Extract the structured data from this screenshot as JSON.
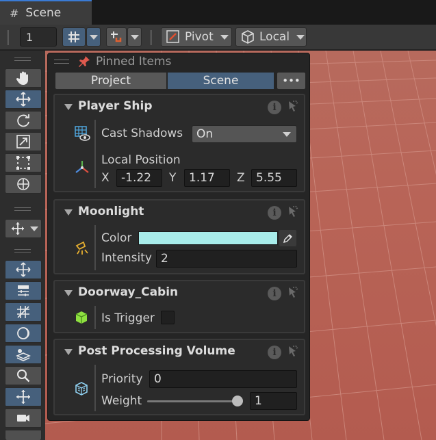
{
  "tab": {
    "title": "Scene",
    "icon": "hash-grid-icon"
  },
  "toolbar": {
    "grid_value": "1",
    "pivot_label": "Pivot",
    "local_label": "Local"
  },
  "palette": {
    "tools": [
      "hand-icon",
      "move-icon",
      "rotate-icon",
      "scale-icon",
      "rect-icon",
      "transform-icon",
      "custom-tool-icon",
      "move-tool-icon",
      "align-icon",
      "grid-snap-icon",
      "sphere-icon",
      "layers-icon",
      "search-icon",
      "gizmo-icon",
      "camera-icon"
    ]
  },
  "overlay": {
    "title": "Pinned Items",
    "tabs": {
      "project": "Project",
      "scene": "Scene",
      "more": "•••"
    },
    "cards": {
      "player": {
        "title": "Player Ship",
        "cast_shadows_label": "Cast Shadows",
        "cast_shadows_value": "On",
        "local_position_label": "Local Position",
        "x_label": "X",
        "x_value": "-1.22",
        "y_label": "Y",
        "y_value": "1.17",
        "z_label": "Z",
        "z_value": "5.55"
      },
      "moonlight": {
        "title": "Moonlight",
        "color_label": "Color",
        "color_value": "#a8ecea",
        "intensity_label": "Intensity",
        "intensity_value": "2"
      },
      "doorway": {
        "title": "Doorway_Cabin",
        "trigger_label": "Is Trigger"
      },
      "postprocess": {
        "title": "Post Processing Volume",
        "priority_label": "Priority",
        "priority_value": "0",
        "weight_label": "Weight",
        "weight_value": "1"
      }
    }
  },
  "colors": {
    "accent": "#46607c",
    "floor": "#b8665a",
    "grid_line": "#d49488"
  }
}
